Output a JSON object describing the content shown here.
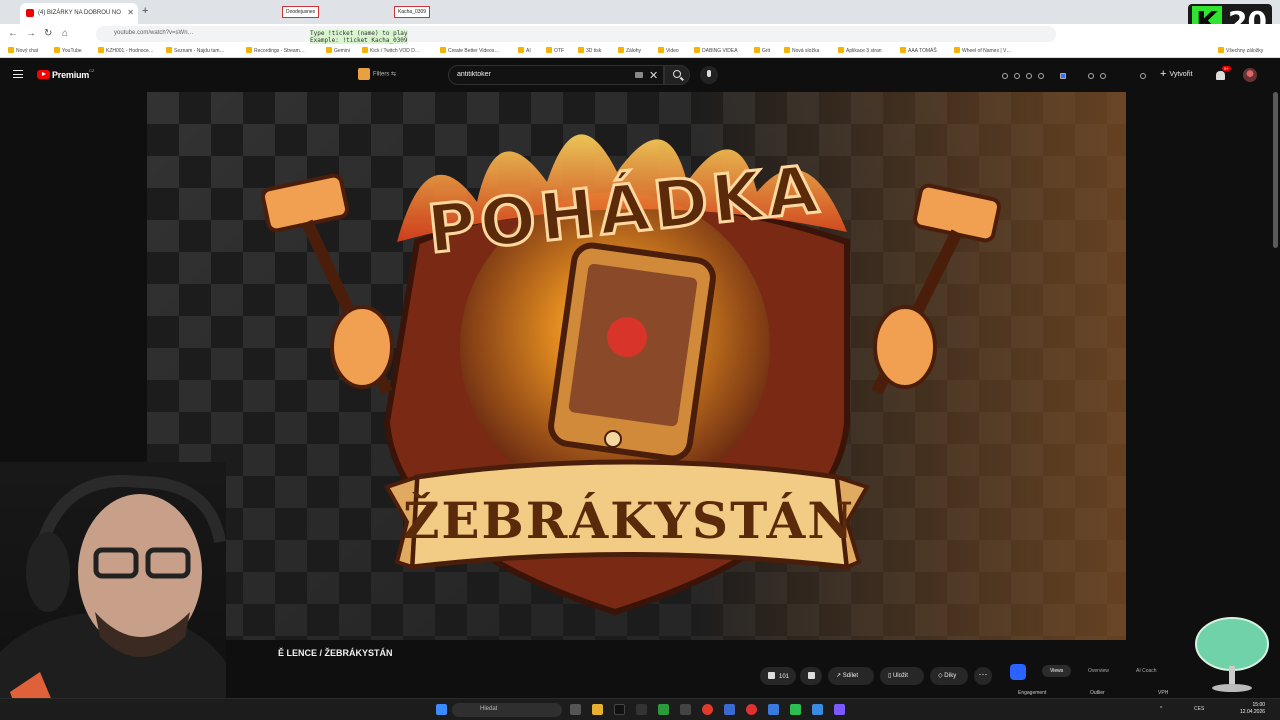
{
  "browser": {
    "tab_title": "(4) BIZÁRKY NA DOBROU NO",
    "url": "youtube.com/watch?v=sWn…",
    "overlay_line1": "Type !ticket (name) to play",
    "overlay_line2": "Example: !ticket Kacha_0309",
    "badge_left": "Doodejusnes",
    "badge_right": "Kacha_0309",
    "bookmarks": [
      "Nový chat",
      "YouTube",
      "KZH001 - Hodnoce…",
      "Seznam - Najdu tam…",
      "Recordings - Stream…",
      "Gemini",
      "Kick / Twitch VOD D…",
      "Create Better Videos…",
      "AI",
      "OTF",
      "3D tisk",
      "Zálohy",
      "Video",
      "DABING VIDEA",
      "Grit",
      "Nová složka",
      "Aplikace 3 stran",
      "AAA TOMÁŠ",
      "Wheel of Names | V…",
      "Všechny záložky"
    ]
  },
  "k20": {
    "letter": "K",
    "number": "20"
  },
  "youtube": {
    "logo_text": "Premium",
    "country_code": "CZ",
    "filters_label": "Filters",
    "search_value": "antitiktoker",
    "create_label": "Vytvořit",
    "notifications": "9+"
  },
  "video": {
    "title_top": "POHÁDKA",
    "title_bottom": "ŽEBRÁKYSTÁN",
    "caption": "Ě LENCE / ŽEBRÁKYSTÁN"
  },
  "actions": {
    "likes": "101",
    "share": "Sdílet",
    "save": "Uložit",
    "thanks": "Díky"
  },
  "analytics": {
    "tabs": [
      "Views",
      "Overview",
      "AI Coach"
    ],
    "subs": [
      "Engagement",
      "Outlier",
      "VPH"
    ]
  },
  "taskbar": {
    "search_label": "Hledat",
    "lang": "CES",
    "time": "15:00",
    "date": "12.04.2026"
  },
  "colors": {
    "accent": "#ff0000",
    "badge": "#2fe52f"
  }
}
